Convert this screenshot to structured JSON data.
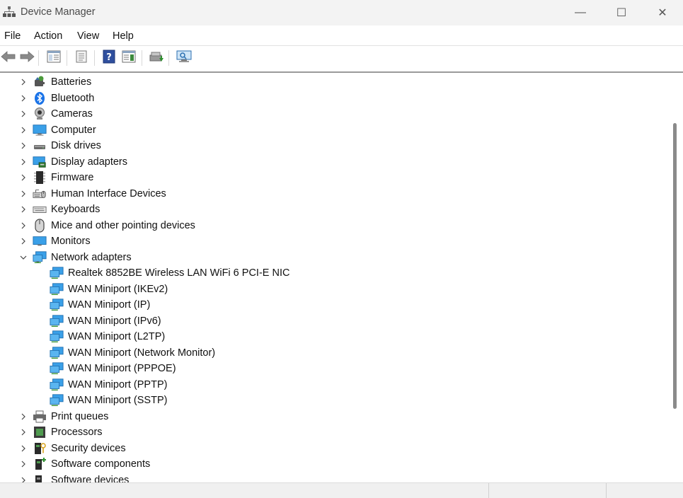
{
  "window": {
    "title": "Device Manager",
    "icons": {
      "app": "device-manager-icon",
      "minimize": "minimize-icon",
      "maximize": "maximize-icon",
      "close": "close-icon"
    },
    "minimize_glyph": "—",
    "maximize_glyph": "☐",
    "close_glyph": "✕"
  },
  "menu": {
    "file": "File",
    "action": "Action",
    "view": "View",
    "help": "Help"
  },
  "toolbar": {
    "buttons": [
      "back-arrow-icon",
      "forward-arrow-icon",
      "show-hide-console-tree-icon",
      "properties-icon",
      "help-icon",
      "action-pane-icon",
      "update-driver-icon",
      "scan-hardware-changes-icon"
    ]
  },
  "tree": {
    "categories": [
      {
        "label": "Batteries",
        "icon": "battery-icon",
        "expanded": false
      },
      {
        "label": "Bluetooth",
        "icon": "bluetooth-icon",
        "expanded": false
      },
      {
        "label": "Cameras",
        "icon": "camera-icon",
        "expanded": false
      },
      {
        "label": "Computer",
        "icon": "computer-icon",
        "expanded": false
      },
      {
        "label": "Disk drives",
        "icon": "disk-drive-icon",
        "expanded": false
      },
      {
        "label": "Display adapters",
        "icon": "display-adapter-icon",
        "expanded": false
      },
      {
        "label": "Firmware",
        "icon": "firmware-icon",
        "expanded": false
      },
      {
        "label": "Human Interface Devices",
        "icon": "hid-icon",
        "expanded": false
      },
      {
        "label": "Keyboards",
        "icon": "keyboard-icon",
        "expanded": false
      },
      {
        "label": "Mice and other pointing devices",
        "icon": "mouse-icon",
        "expanded": false
      },
      {
        "label": "Monitors",
        "icon": "monitor-icon",
        "expanded": false
      },
      {
        "label": "Network adapters",
        "icon": "network-adapter-icon",
        "expanded": true
      }
    ],
    "network_children": [
      "Realtek 8852BE Wireless LAN WiFi 6 PCI-E NIC",
      "WAN Miniport (IKEv2)",
      "WAN Miniport (IP)",
      "WAN Miniport (IPv6)",
      "WAN Miniport (L2TP)",
      "WAN Miniport (Network Monitor)",
      "WAN Miniport (PPPOE)",
      "WAN Miniport (PPTP)",
      "WAN Miniport (SSTP)"
    ],
    "after_categories": [
      {
        "label": "Print queues",
        "icon": "printer-icon",
        "expanded": false
      },
      {
        "label": "Processors",
        "icon": "processor-icon",
        "expanded": false
      },
      {
        "label": "Security devices",
        "icon": "security-device-icon",
        "expanded": false
      },
      {
        "label": "Software components",
        "icon": "software-component-icon",
        "expanded": false
      },
      {
        "label": "Software devices",
        "icon": "software-device-icon",
        "expanded": false
      }
    ]
  },
  "colors": {
    "titlebar_bg": "#f3f3f3",
    "network_blue": "#2b8fd6",
    "status_bg": "#f0f0f0"
  }
}
